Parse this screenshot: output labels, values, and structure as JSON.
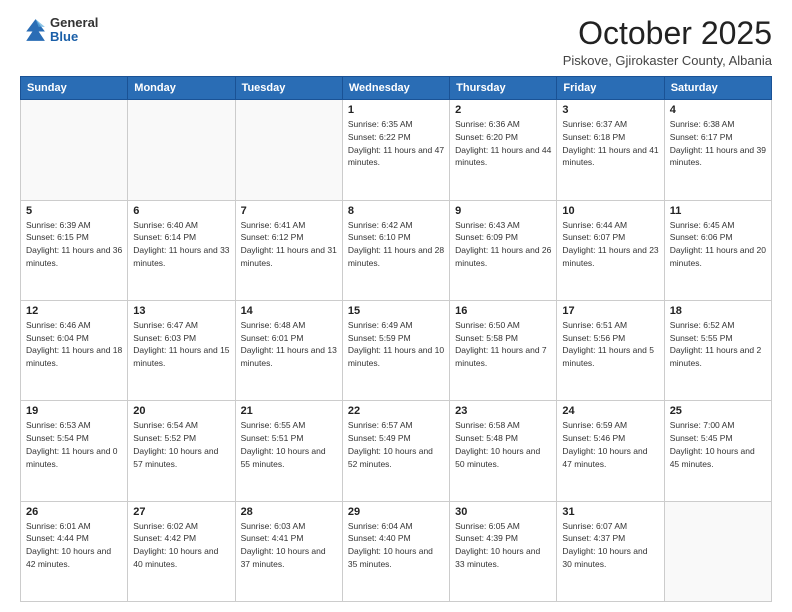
{
  "header": {
    "logo_general": "General",
    "logo_blue": "Blue",
    "month_title": "October 2025",
    "subtitle": "Piskove, Gjirokaster County, Albania"
  },
  "days_of_week": [
    "Sunday",
    "Monday",
    "Tuesday",
    "Wednesday",
    "Thursday",
    "Friday",
    "Saturday"
  ],
  "weeks": [
    [
      {
        "day": "",
        "info": ""
      },
      {
        "day": "",
        "info": ""
      },
      {
        "day": "",
        "info": ""
      },
      {
        "day": "1",
        "info": "Sunrise: 6:35 AM\nSunset: 6:22 PM\nDaylight: 11 hours and 47 minutes."
      },
      {
        "day": "2",
        "info": "Sunrise: 6:36 AM\nSunset: 6:20 PM\nDaylight: 11 hours and 44 minutes."
      },
      {
        "day": "3",
        "info": "Sunrise: 6:37 AM\nSunset: 6:18 PM\nDaylight: 11 hours and 41 minutes."
      },
      {
        "day": "4",
        "info": "Sunrise: 6:38 AM\nSunset: 6:17 PM\nDaylight: 11 hours and 39 minutes."
      }
    ],
    [
      {
        "day": "5",
        "info": "Sunrise: 6:39 AM\nSunset: 6:15 PM\nDaylight: 11 hours and 36 minutes."
      },
      {
        "day": "6",
        "info": "Sunrise: 6:40 AM\nSunset: 6:14 PM\nDaylight: 11 hours and 33 minutes."
      },
      {
        "day": "7",
        "info": "Sunrise: 6:41 AM\nSunset: 6:12 PM\nDaylight: 11 hours and 31 minutes."
      },
      {
        "day": "8",
        "info": "Sunrise: 6:42 AM\nSunset: 6:10 PM\nDaylight: 11 hours and 28 minutes."
      },
      {
        "day": "9",
        "info": "Sunrise: 6:43 AM\nSunset: 6:09 PM\nDaylight: 11 hours and 26 minutes."
      },
      {
        "day": "10",
        "info": "Sunrise: 6:44 AM\nSunset: 6:07 PM\nDaylight: 11 hours and 23 minutes."
      },
      {
        "day": "11",
        "info": "Sunrise: 6:45 AM\nSunset: 6:06 PM\nDaylight: 11 hours and 20 minutes."
      }
    ],
    [
      {
        "day": "12",
        "info": "Sunrise: 6:46 AM\nSunset: 6:04 PM\nDaylight: 11 hours and 18 minutes."
      },
      {
        "day": "13",
        "info": "Sunrise: 6:47 AM\nSunset: 6:03 PM\nDaylight: 11 hours and 15 minutes."
      },
      {
        "day": "14",
        "info": "Sunrise: 6:48 AM\nSunset: 6:01 PM\nDaylight: 11 hours and 13 minutes."
      },
      {
        "day": "15",
        "info": "Sunrise: 6:49 AM\nSunset: 5:59 PM\nDaylight: 11 hours and 10 minutes."
      },
      {
        "day": "16",
        "info": "Sunrise: 6:50 AM\nSunset: 5:58 PM\nDaylight: 11 hours and 7 minutes."
      },
      {
        "day": "17",
        "info": "Sunrise: 6:51 AM\nSunset: 5:56 PM\nDaylight: 11 hours and 5 minutes."
      },
      {
        "day": "18",
        "info": "Sunrise: 6:52 AM\nSunset: 5:55 PM\nDaylight: 11 hours and 2 minutes."
      }
    ],
    [
      {
        "day": "19",
        "info": "Sunrise: 6:53 AM\nSunset: 5:54 PM\nDaylight: 11 hours and 0 minutes."
      },
      {
        "day": "20",
        "info": "Sunrise: 6:54 AM\nSunset: 5:52 PM\nDaylight: 10 hours and 57 minutes."
      },
      {
        "day": "21",
        "info": "Sunrise: 6:55 AM\nSunset: 5:51 PM\nDaylight: 10 hours and 55 minutes."
      },
      {
        "day": "22",
        "info": "Sunrise: 6:57 AM\nSunset: 5:49 PM\nDaylight: 10 hours and 52 minutes."
      },
      {
        "day": "23",
        "info": "Sunrise: 6:58 AM\nSunset: 5:48 PM\nDaylight: 10 hours and 50 minutes."
      },
      {
        "day": "24",
        "info": "Sunrise: 6:59 AM\nSunset: 5:46 PM\nDaylight: 10 hours and 47 minutes."
      },
      {
        "day": "25",
        "info": "Sunrise: 7:00 AM\nSunset: 5:45 PM\nDaylight: 10 hours and 45 minutes."
      }
    ],
    [
      {
        "day": "26",
        "info": "Sunrise: 6:01 AM\nSunset: 4:44 PM\nDaylight: 10 hours and 42 minutes."
      },
      {
        "day": "27",
        "info": "Sunrise: 6:02 AM\nSunset: 4:42 PM\nDaylight: 10 hours and 40 minutes."
      },
      {
        "day": "28",
        "info": "Sunrise: 6:03 AM\nSunset: 4:41 PM\nDaylight: 10 hours and 37 minutes."
      },
      {
        "day": "29",
        "info": "Sunrise: 6:04 AM\nSunset: 4:40 PM\nDaylight: 10 hours and 35 minutes."
      },
      {
        "day": "30",
        "info": "Sunrise: 6:05 AM\nSunset: 4:39 PM\nDaylight: 10 hours and 33 minutes."
      },
      {
        "day": "31",
        "info": "Sunrise: 6:07 AM\nSunset: 4:37 PM\nDaylight: 10 hours and 30 minutes."
      },
      {
        "day": "",
        "info": ""
      }
    ]
  ]
}
